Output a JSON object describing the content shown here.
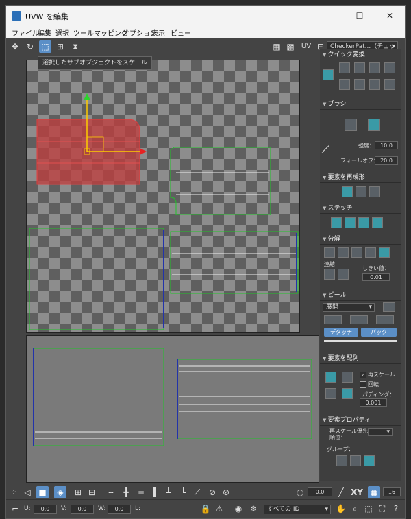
{
  "window": {
    "title": "UVW を編集"
  },
  "menu": [
    "ファイル",
    "編集",
    "選択",
    "ツール",
    "マッピング",
    "オプション",
    "表示",
    "ビュー"
  ],
  "tooltip": "選択したサブオブジェクトをスケール",
  "toolbar_right": {
    "uv_label": "UV",
    "texture_combo": "CheckerPat...（チェック）"
  },
  "panel": {
    "quick_transform": "クイック変換",
    "brush": "ブラシ",
    "strength_label": "強度：",
    "strength_value": "10.0",
    "falloff_label": "フォールオフ：",
    "falloff_value": "20.0",
    "reshape": "要素を再成形",
    "stitch": "ステッチ",
    "explode": "分解",
    "weld_label": "連結",
    "threshold_label": "しきい値：",
    "threshold_value": "0.01",
    "peel": "ピール",
    "unfold_select": "展開",
    "detach_btn": "デタッチ",
    "pack_btn": "パック",
    "arrange": "要素を配列",
    "rescale_label": "再スケール",
    "rotate_label": "回転",
    "padding_label": "パディング：",
    "padding_value": "0.001",
    "properties": "要素プロパティ",
    "rescale_priority_label": "再スケール優先順位：",
    "groups_label": "グループ："
  },
  "bottom": {
    "angle_value": "0.0",
    "xy_label": "XY",
    "grid_value": "16",
    "u_label": "U:",
    "u_value": "0.0",
    "v_label": "V:",
    "v_value": "0.0",
    "w_label": "W:",
    "w_value": "0.0",
    "l_label": "L:",
    "id_select": "すべての ID"
  },
  "colors": {
    "accent_blue": "#5b8fc7",
    "selection_red": "#c23c3c",
    "uv_green": "#22c22a"
  }
}
